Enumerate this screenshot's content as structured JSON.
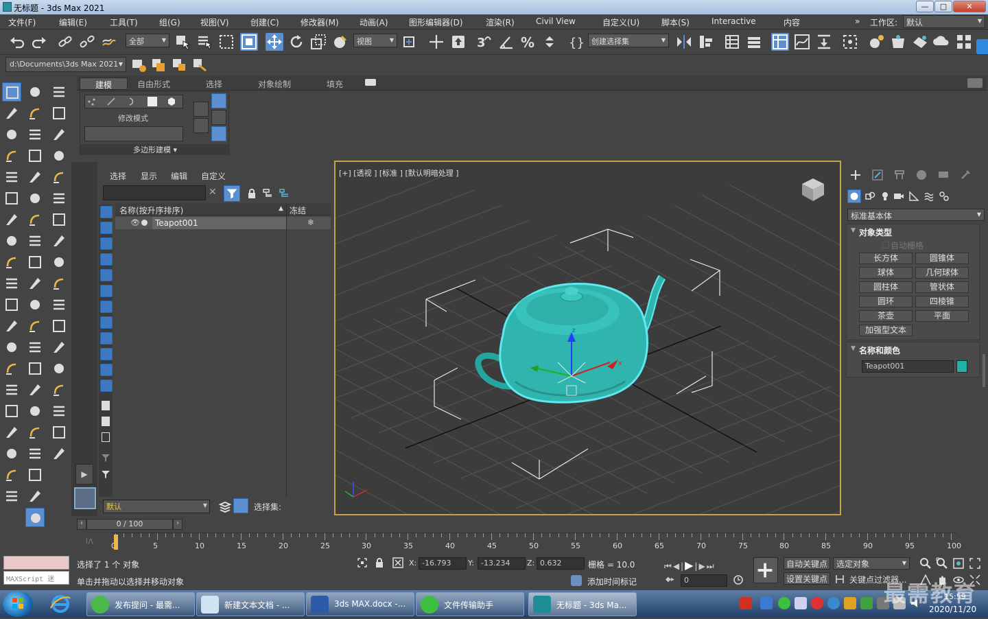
{
  "window": {
    "title": "无标题 - 3ds Max 2021",
    "min": "—",
    "max": "□",
    "close": "✕"
  },
  "menu": [
    "文件(F)",
    "编辑(E)",
    "工具(T)",
    "组(G)",
    "视图(V)",
    "创建(C)",
    "修改器(M)",
    "动画(A)",
    "图形编辑器(D)",
    "渲染(R)",
    "Civil View",
    "自定义(U)",
    "脚本(S)",
    "Interactive",
    "内容"
  ],
  "workspace": {
    "label": "工作区:",
    "value": "默认",
    "arrow": "»"
  },
  "toolbar": {
    "filter": "全部",
    "refcoord": "视图",
    "selset": "创建选择集"
  },
  "path": "d:\\Documents\\3ds Max 2021",
  "ribbon": {
    "tabs": [
      "建模",
      "自由形式",
      "选择",
      "对象绘制",
      "填充"
    ],
    "modify_mode": "修改模式",
    "poly_modeling": "多边形建模 ▾"
  },
  "scene_explorer": {
    "tabs": [
      "选择",
      "显示",
      "编辑",
      "自定义"
    ],
    "col_name": "名称(按升序排序)",
    "col_freeze": "冻结",
    "sort_arrow": "▲",
    "rows": [
      {
        "name": "Teapot001",
        "freeze": "❄"
      }
    ],
    "layer": "默认",
    "selset_label": "选择集:"
  },
  "viewport": {
    "label": "[+] [透视 ] [标准 ] [默认明暗处理 ]",
    "object_color": "#2fb5ae"
  },
  "command_panel": {
    "category": "标准基本体",
    "rollout1": "对象类型",
    "autogrid": "自动栅格",
    "buttons": [
      "长方体",
      "圆锥体",
      "球体",
      "几何球体",
      "圆柱体",
      "管状体",
      "圆环",
      "四棱锥",
      "茶壶",
      "平面",
      "加强型文本"
    ],
    "rollout2": "名称和颜色",
    "object_name": "Teapot001",
    "swatch_color": "#1fb3a6"
  },
  "timeline": {
    "frame": "0 / 100",
    "ticks": [
      "0",
      "5",
      "10",
      "15",
      "20",
      "25",
      "30",
      "35",
      "40",
      "45",
      "50",
      "55",
      "60",
      "65",
      "70",
      "75",
      "80",
      "85",
      "90",
      "95",
      "100"
    ]
  },
  "status": {
    "maxscript": "MAXScript 迷",
    "selected": "选择了 1 个 对象",
    "hint": "单击并拖动以选择并移动对象",
    "x_label": "X:",
    "x": "-16.793",
    "y_label": "Y:",
    "y": "-13.234",
    "z_label": "Z:",
    "z": "0.632",
    "grid": "栅格 = 10.0",
    "add_time_tag": "添加时间标记",
    "autokey": "自动关键点",
    "selected_obj": "选定对象",
    "set_key": "设置关键点",
    "key_filter": "关键点过滤器...",
    "frame_field": "0"
  },
  "taskbar": {
    "items": [
      "发布提问 - 最需...",
      "新建文本文档 - ...",
      "3ds MAX.docx -...",
      "文件传输助手",
      "无标题 - 3ds Ma..."
    ],
    "time": "15:59",
    "date": "2020/11/20",
    "watermark": "最需教育"
  }
}
